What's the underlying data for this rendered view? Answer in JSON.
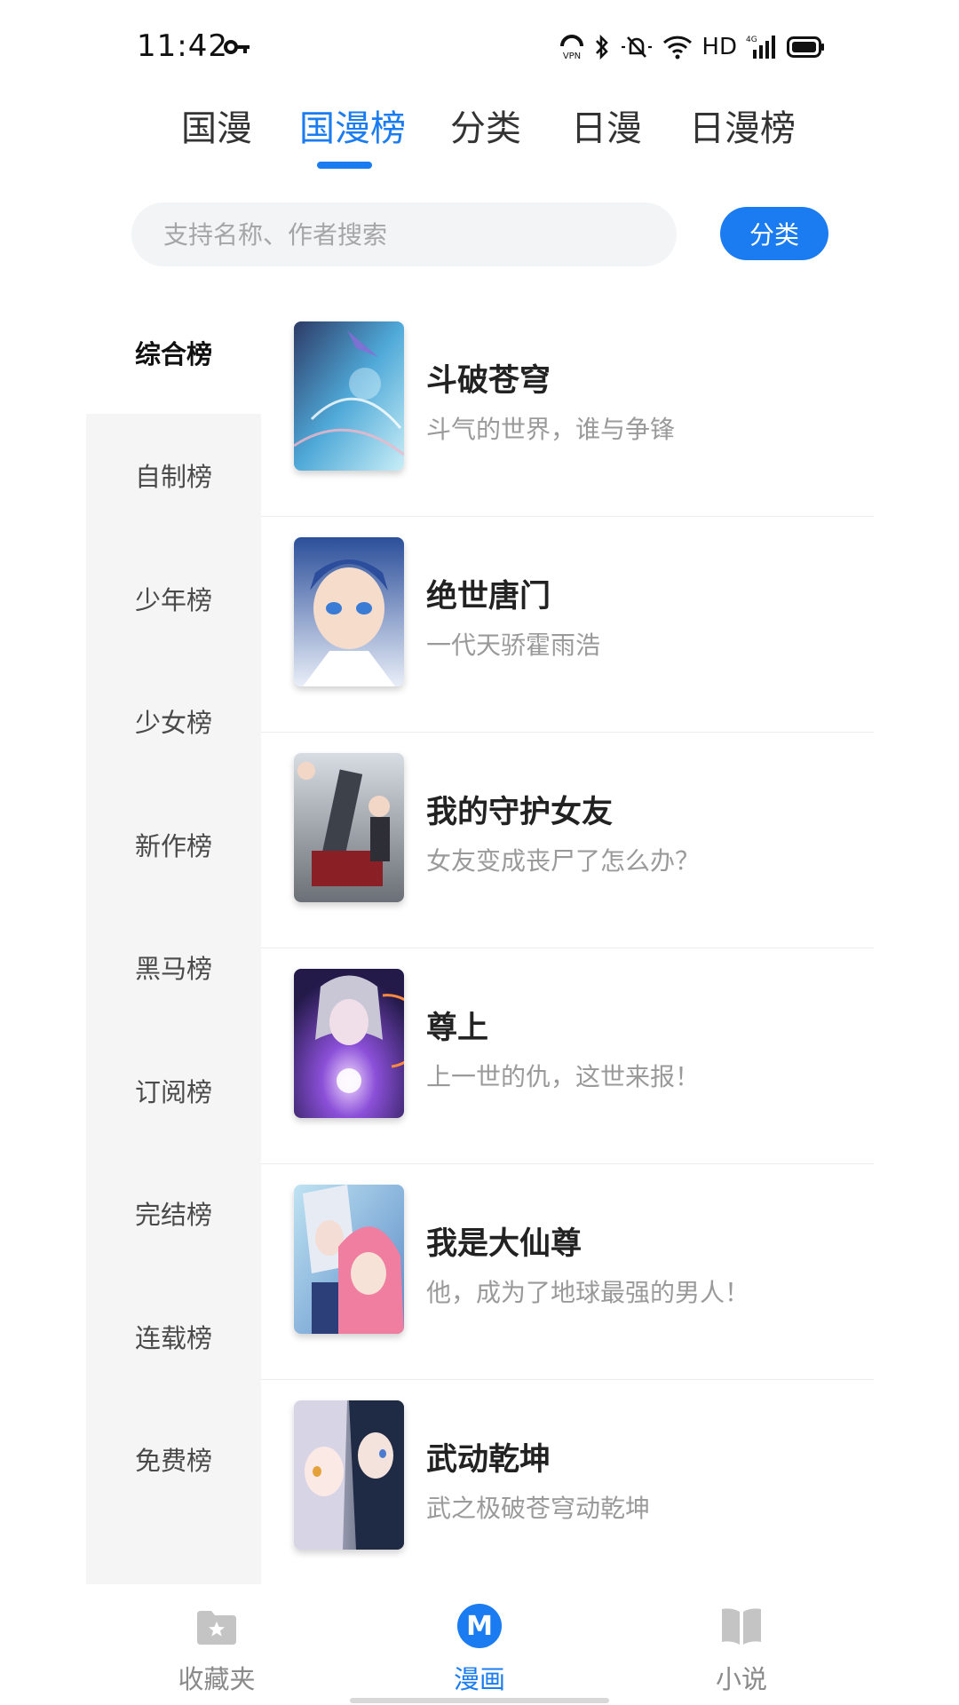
{
  "status_bar": {
    "time": "11:42",
    "icons": [
      "key-icon",
      "vpn-icon",
      "bluetooth-icon",
      "mute-icon",
      "wifi-icon",
      "signal-icon",
      "battery-icon"
    ],
    "network_label": "HD",
    "network_type": "4G"
  },
  "top_tabs": [
    {
      "label": "国漫",
      "active": false
    },
    {
      "label": "国漫榜",
      "active": true
    },
    {
      "label": "分类",
      "active": false
    },
    {
      "label": "日漫",
      "active": false
    },
    {
      "label": "日漫榜",
      "active": false
    }
  ],
  "search": {
    "placeholder": "支持名称、作者搜索",
    "value": "",
    "button_label": "分类"
  },
  "sidebar": {
    "items": [
      {
        "label": "综合榜",
        "active": true
      },
      {
        "label": "自制榜",
        "active": false
      },
      {
        "label": "少年榜",
        "active": false
      },
      {
        "label": "少女榜",
        "active": false
      },
      {
        "label": "新作榜",
        "active": false
      },
      {
        "label": "黑马榜",
        "active": false
      },
      {
        "label": "订阅榜",
        "active": false
      },
      {
        "label": "完结榜",
        "active": false
      },
      {
        "label": "连载榜",
        "active": false
      },
      {
        "label": "免费榜",
        "active": false
      }
    ]
  },
  "comics": [
    {
      "title": "斗破苍穹",
      "desc": "斗气的世界，谁与争锋"
    },
    {
      "title": "绝世唐门",
      "desc": "一代天骄霍雨浩"
    },
    {
      "title": "我的守护女友",
      "desc": "女友变成丧尸了怎么办？"
    },
    {
      "title": "尊上",
      "desc": "上一世的仇，这世来报！"
    },
    {
      "title": "我是大仙尊",
      "desc": "他，成为了地球最强的男人！"
    },
    {
      "title": "武动乾坤",
      "desc": "武之极破苍穹动乾坤"
    }
  ],
  "bottom_nav": [
    {
      "label": "收藏夹",
      "icon": "star-folder-icon",
      "active": false
    },
    {
      "label": "漫画",
      "icon": "manga-m-icon",
      "icon_letter": "M",
      "active": true
    },
    {
      "label": "小说",
      "icon": "open-book-icon",
      "active": false
    }
  ],
  "colors": {
    "accent": "#1a7cf0",
    "sidebar_bg": "#f5f5f5",
    "muted_text": "#9a9a9a"
  }
}
